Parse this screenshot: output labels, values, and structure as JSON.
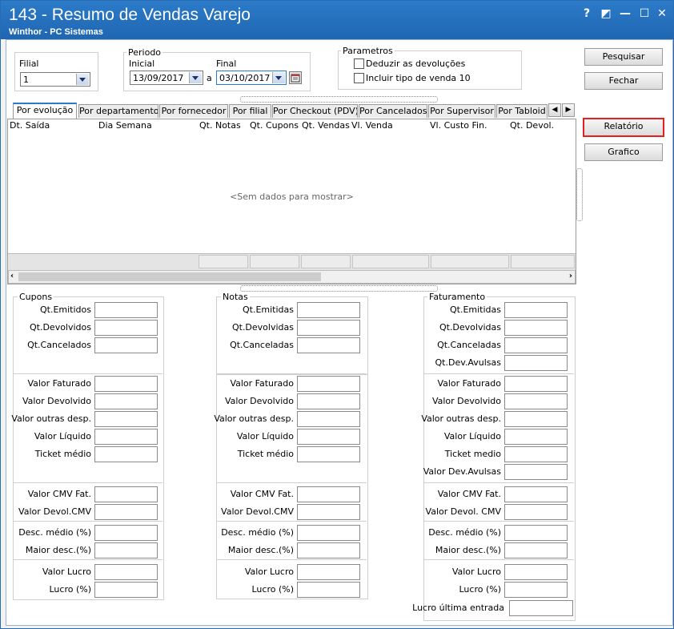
{
  "window": {
    "title": "143 - Resumo de Vendas Varejo",
    "subtitle": "Winthor - PC Sistemas",
    "controls": {
      "help": "?",
      "restore": "◩",
      "minimize": "—",
      "maximize": "☐",
      "close": "✕"
    }
  },
  "filter": {
    "filial_label": "Filial",
    "filial_value": "1",
    "periodo_label": "Periodo",
    "inicial_label": "Inicial",
    "inicial_value": "13/09/2017",
    "a_label": "a",
    "final_label": "Final",
    "final_value": "03/10/2017"
  },
  "parametros": {
    "label": "Parametros",
    "deduzir": "Deduzir as devoluções",
    "incluir": "Incluir tipo de venda 10"
  },
  "buttons": {
    "pesquisar": "Pesquisar",
    "fechar": "Fechar",
    "relatorio": "Relatório",
    "grafico": "Grafico"
  },
  "tabs": [
    "Por evolução",
    "Por departamento",
    "Por fornecedor",
    "Por filial",
    "Por Checkout (PDV)",
    "Por Cancelados",
    "Por Supervisor",
    "Por Tabloid"
  ],
  "grid": {
    "columns": [
      "Dt. Saída",
      "Dia Semana",
      "Qt. Notas",
      "Qt. Cupons",
      "Qt. Vendas",
      "Vl. Venda",
      "Vl. Custo Fin.",
      "Qt. Devol."
    ],
    "empty": "<Sem dados para mostrar>"
  },
  "cupons": {
    "title": "Cupons",
    "rows": [
      "Qt.Emitidos",
      "Qt.Devolvidos",
      "Qt.Cancelados",
      "Valor Faturado",
      "Valor Devolvido",
      "Valor outras desp.",
      "Valor Líquido",
      "Ticket médio",
      "Valor CMV Fat.",
      "Valor Devol.CMV",
      "Desc. médio (%)",
      "Maior desc.(%)",
      "Valor Lucro",
      "Lucro (%)"
    ]
  },
  "notas": {
    "title": "Notas",
    "rows": [
      "Qt.Emitidas",
      "Qt.Devolvidas",
      "Qt.Canceladas",
      "Valor Faturado",
      "Valor Devolvido",
      "Valor outras desp.",
      "Valor Líquido",
      "Ticket médio",
      "Valor CMV Fat.",
      "Valor Devol.CMV",
      "Desc. médio (%)",
      "Maior desc.(%)",
      "Valor Lucro",
      "Lucro (%)"
    ]
  },
  "faturamento": {
    "title": "Faturamento",
    "rows": [
      "Qt.Emitidas",
      "Qt.Devolvidas",
      "Qt.Canceladas",
      "Qt.Dev.Avulsas",
      "Valor Faturado",
      "Valor Devolvido",
      "Valor outras desp.",
      "Valor Líquido",
      "Ticket medio",
      "Valor Dev.Avulsas",
      "Valor CMV Fat.",
      "Valor Devol. CMV",
      "Desc. médio (%)",
      "Maior desc.(%)",
      "Valor Lucro",
      "Lucro (%)",
      "Lucro última entrada"
    ]
  }
}
